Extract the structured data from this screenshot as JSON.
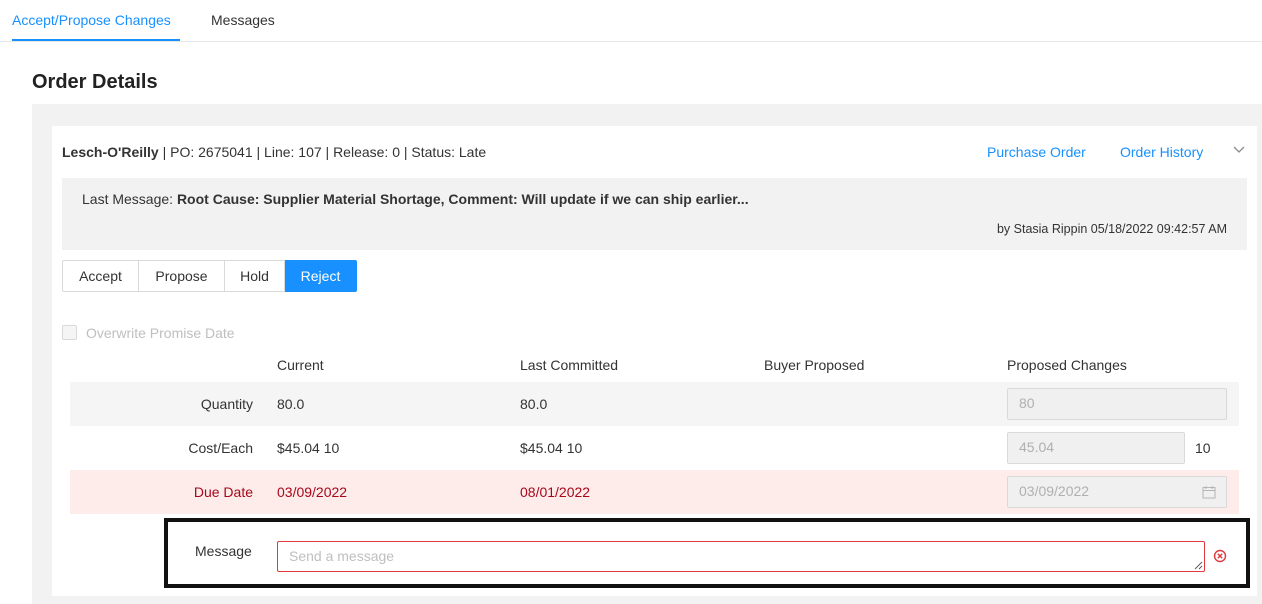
{
  "tabs": [
    {
      "label": "Accept/Propose Changes",
      "active": true
    },
    {
      "label": "Messages",
      "active": false
    }
  ],
  "page": {
    "title": "Order Details"
  },
  "order": {
    "supplier": "Lesch-O'Reilly",
    "meta": " | PO: 2675041 | Line: 107 | Release: 0 | Status: Late",
    "links": {
      "purchase_order": "Purchase Order",
      "order_history": "Order History"
    }
  },
  "last_message": {
    "prefix": "Last Message: ",
    "content": "Root Cause: Supplier Material Shortage, Comment: Will update if we can ship earlier...",
    "byline": "by Stasia Rippin 05/18/2022 09:42:57 AM"
  },
  "actions": {
    "buttons": [
      "Accept",
      "Propose",
      "Hold",
      "Reject"
    ],
    "selected": "Reject"
  },
  "overwrite_promise_date": {
    "label": "Overwrite Promise Date",
    "checked": false,
    "disabled": true
  },
  "table": {
    "headers": {
      "current": "Current",
      "last_committed": "Last Committed",
      "buyer_proposed": "Buyer Proposed",
      "proposed_changes": "Proposed Changes"
    },
    "quantity": {
      "label": "Quantity",
      "current": "80.0",
      "last_committed": "80.0",
      "buyer_proposed": "",
      "proposed": "80"
    },
    "cost": {
      "label": "Cost/Each",
      "current": "$45.04 10",
      "last_committed": "$45.04 10",
      "buyer_proposed": "",
      "proposed": "45.04",
      "per": "10"
    },
    "due_date": {
      "label": "Due Date",
      "current": "03/09/2022",
      "last_committed": "08/01/2022",
      "buyer_proposed": "",
      "proposed": "03/09/2022"
    }
  },
  "message": {
    "label": "Message",
    "placeholder": "Send a message",
    "value": ""
  },
  "colors": {
    "primary": "#1890ff",
    "error": "#e0393e",
    "late_row_bg": "#fdecea",
    "late_text": "#a8071a"
  },
  "icons": [
    "chevron-down-icon",
    "calendar-icon",
    "error-circle-icon",
    "resize-grip-icon"
  ]
}
